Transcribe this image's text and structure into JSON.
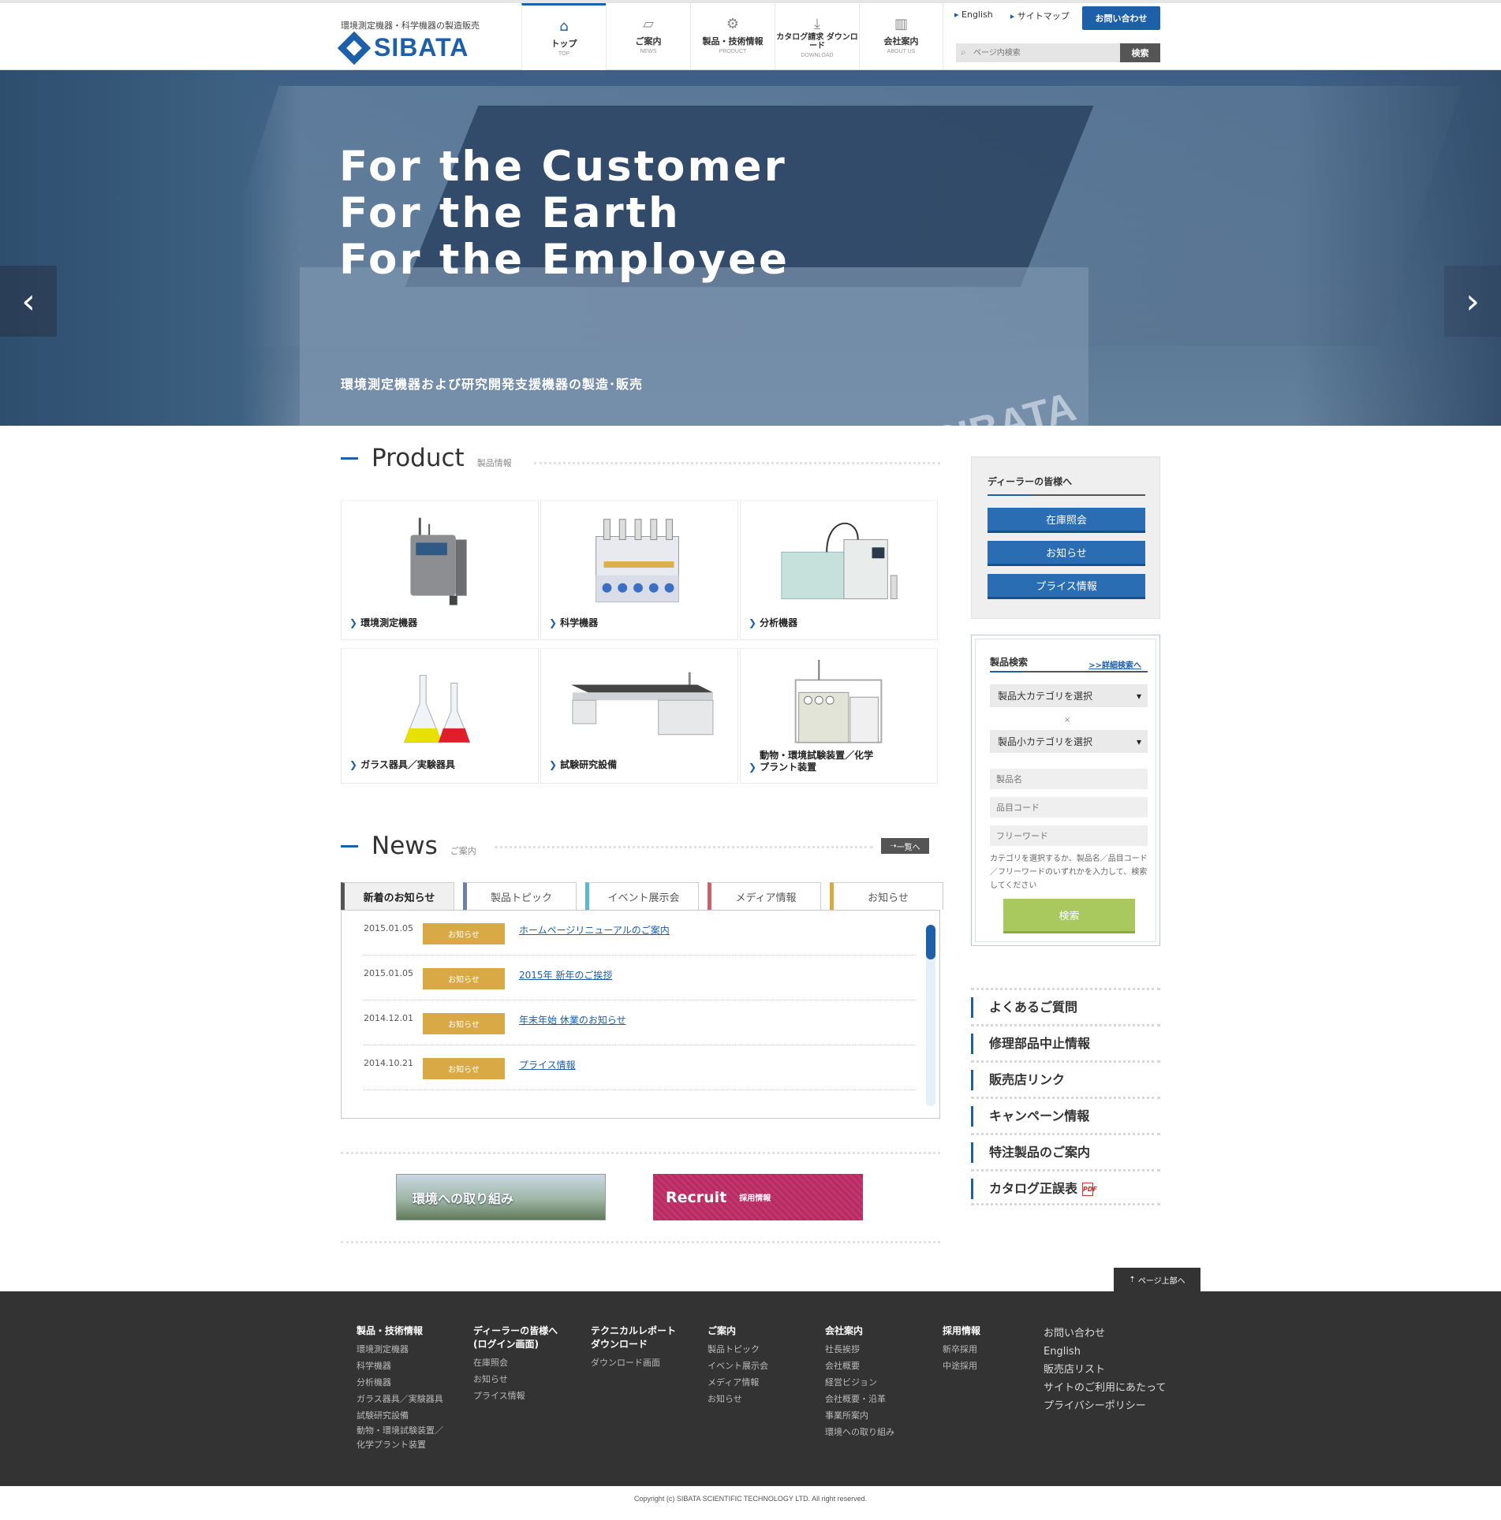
{
  "header": {
    "tagline": "環境測定機器・科学機器の製造販売",
    "logo_text": "SIBATA",
    "nav": [
      {
        "label": "トップ",
        "sub": "TOP",
        "icon": "home-icon"
      },
      {
        "label": "ご案内",
        "sub": "NEWS",
        "icon": "news-icon"
      },
      {
        "label": "製品・技術情報",
        "sub": "PRODUCT",
        "icon": "gear-icon"
      },
      {
        "label": "カタログ請求 ダウンロード",
        "sub": "DOWNLOAD",
        "icon": "download-icon"
      },
      {
        "label": "会社案内",
        "sub": "ABOUT US",
        "icon": "building-icon"
      }
    ],
    "util_links": [
      "English",
      "サイトマップ"
    ],
    "contact": "お問い合わせ",
    "search_placeholder": "ページ内検索",
    "search_button": "検索"
  },
  "hero": {
    "lines": [
      "For the Customer",
      "For the Earth",
      "For the Employee"
    ],
    "subtitle": "環境測定機器および研究開発支援機器の製造･販売",
    "sign": "SIBATA",
    "slide_count": 5,
    "active_slide": 1
  },
  "product": {
    "title": "Product",
    "subtitle": "製品情報",
    "items": [
      "環境測定機器",
      "科学機器",
      "分析機器",
      "ガラス器具／実験器具",
      "試験研究設備",
      "動物・環境試験装置／化学プラント装置"
    ]
  },
  "news": {
    "title": "News",
    "subtitle": "ご案内",
    "more": "一覧へ",
    "tabs": [
      {
        "label": "新着のお知らせ",
        "color": "#555555"
      },
      {
        "label": "製品トピック",
        "color": "#6b7fb3"
      },
      {
        "label": "イベント展示会",
        "color": "#5bb8c9"
      },
      {
        "label": "メディア情報",
        "color": "#c9606a"
      },
      {
        "label": "お知らせ",
        "color": "#d9a945"
      }
    ],
    "items": [
      {
        "date": "2015.01.05",
        "category": "お知らせ",
        "title": "ホームページリニューアルのご案内"
      },
      {
        "date": "2015.01.05",
        "category": "お知らせ",
        "title": "2015年 新年のご挨拶"
      },
      {
        "date": "2014.12.01",
        "category": "お知らせ",
        "title": "年末年始 休業のお知らせ"
      },
      {
        "date": "2014.10.21",
        "category": "お知らせ",
        "title": "プライス情報"
      }
    ]
  },
  "banners": {
    "environment": "環境への取り組み",
    "recruit": "Recruit",
    "recruit_sub": "採用情報"
  },
  "sidebar": {
    "dealer_title": "ディーラーの皆様へ",
    "dealer_buttons": [
      "在庫照会",
      "お知らせ",
      "プライス情報"
    ],
    "search_title": "製品検索",
    "search_advanced": ">>詳細検索へ",
    "select_large": "製品大カテゴリを選択",
    "select_small": "製品小カテゴリを選択",
    "cross": "×",
    "placeholders": [
      "製品名",
      "品目コード",
      "フリーワード"
    ],
    "help": "カテゴリを選択するか、製品名／品目コード／フリーワードのいずれかを入力して、検索してください",
    "search_button": "検索",
    "links": [
      "よくあるご質問",
      "修理部品中止情報",
      "販売店リンク",
      "キャンペーン情報",
      "特注製品のご案内",
      "カタログ正誤表"
    ]
  },
  "pagetop": "ページ上部へ",
  "footer": {
    "columns": [
      {
        "heading": "製品・技術情報",
        "items": [
          "環境測定機器",
          "科学機器",
          "分析機器",
          "ガラス器具／実験器具",
          "試験研究設備",
          "動物・環境試験装置／",
          "化学プラント装置"
        ]
      },
      {
        "heading": "ディーラーの皆様へ (ログイン画面)",
        "items": [
          "在庫照会",
          "お知らせ",
          "プライス情報"
        ]
      },
      {
        "heading": "テクニカルレポート ダウンロード",
        "items": [
          "ダウンロード画面"
        ]
      },
      {
        "heading": "ご案内",
        "items": [
          "製品トピック",
          "イベント展示会",
          "メディア情報",
          "お知らせ"
        ]
      },
      {
        "heading": "会社案内",
        "items": [
          "社長挨拶",
          "会社概要",
          "経営ビジョン",
          "会社概要・沿革",
          "事業所案内",
          "環境への取り組み"
        ]
      },
      {
        "heading": "採用情報",
        "items": [
          "新卒採用",
          "中途採用"
        ]
      }
    ],
    "plain_links": [
      "お問い合わせ",
      "English",
      "販売店リスト",
      "サイトのご利用にあたって",
      "プライバシーポリシー"
    ],
    "copyright": "Copyright (c) SIBATA SCIENTIFIC TECHNOLOGY LTD. All right reserved."
  }
}
